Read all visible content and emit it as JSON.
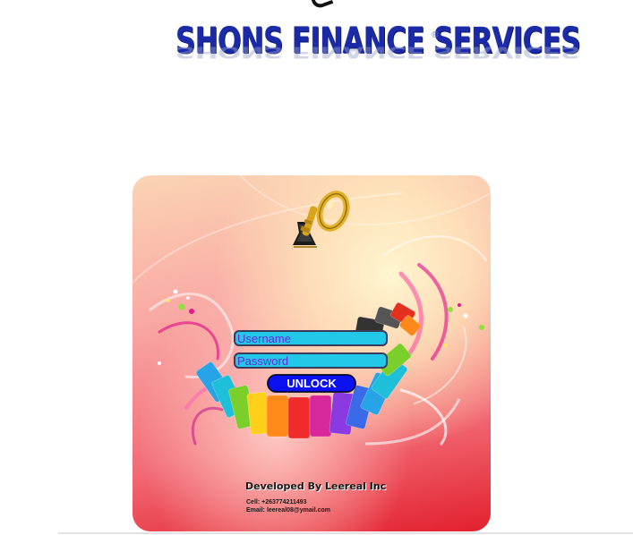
{
  "header": {
    "logo_text": "SHONS FINANCE SERVICES",
    "logo_registered": "®"
  },
  "login": {
    "username_placeholder": "Username",
    "password_placeholder": "Password",
    "unlock_label": "UNLOCK"
  },
  "credits": {
    "developer": "Developed By Leereal Inc",
    "cell": "Cell: +263774211493",
    "email": "Email: leereal08@ymail.com"
  },
  "icons": {
    "key": "key-icon"
  },
  "colors": {
    "logo_blue": "#1a2aa8",
    "field_bg": "#22c8e8",
    "field_text": "#6a2ad8",
    "button_bg": "#0a10f0",
    "button_text": "#ffffff",
    "panel_top": "#fbd4b4",
    "panel_bottom": "#e3202e"
  }
}
